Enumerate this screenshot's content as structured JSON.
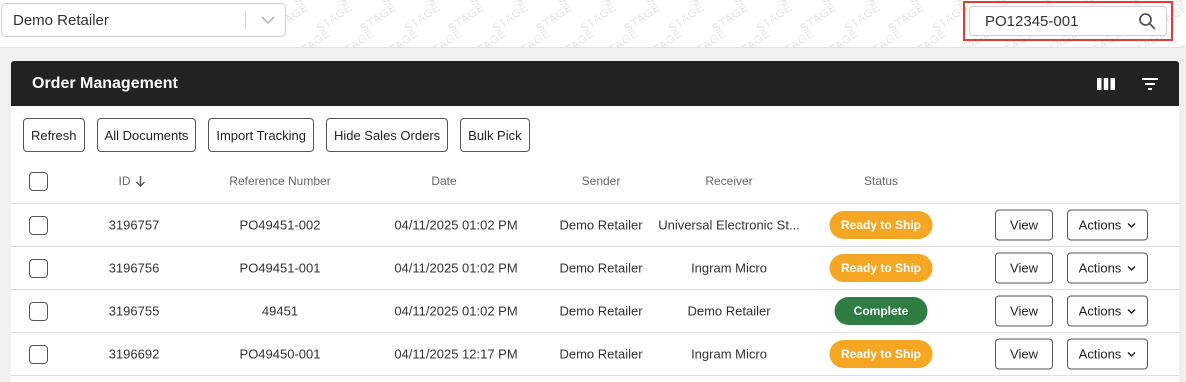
{
  "retailer_select": {
    "value": "Demo Retailer"
  },
  "search": {
    "value": "PO12345-001"
  },
  "watermark_text": "STAGE",
  "card": {
    "title": "Order Management"
  },
  "toolbar": {
    "refresh": "Refresh",
    "all_documents": "All Documents",
    "import_tracking": "Import Tracking",
    "hide_sales_orders": "Hide Sales Orders",
    "bulk_pick": "Bulk Pick"
  },
  "columns": {
    "id": "ID",
    "reference_number": "Reference Number",
    "date": "Date",
    "sender": "Sender",
    "receiver": "Receiver",
    "status": "Status"
  },
  "rows": [
    {
      "id": "3196757",
      "reference": "PO49451-002",
      "date": "04/11/2025 01:02 PM",
      "sender": "Demo Retailer",
      "receiver": "Universal Electronic St...",
      "status": "Ready to Ship"
    },
    {
      "id": "3196756",
      "reference": "PO49451-001",
      "date": "04/11/2025 01:02 PM",
      "sender": "Demo Retailer",
      "receiver": "Ingram Micro",
      "status": "Ready to Ship"
    },
    {
      "id": "3196755",
      "reference": "49451",
      "date": "04/11/2025 01:02 PM",
      "sender": "Demo Retailer",
      "receiver": "Demo Retailer",
      "status": "Complete"
    },
    {
      "id": "3196692",
      "reference": "PO49450-001",
      "date": "04/11/2025 12:17 PM",
      "sender": "Demo Retailer",
      "receiver": "Ingram Micro",
      "status": "Ready to Ship"
    }
  ],
  "row_actions": {
    "view": "View",
    "actions": "Actions"
  },
  "colors": {
    "header_bg": "#222222",
    "ready_to_ship": "#f5a623",
    "complete": "#2e7d42",
    "highlight_border": "#e53935"
  },
  "icons": {
    "select_chevron": "chevron-down-icon",
    "search": "search-icon",
    "columns": "columns-icon",
    "filter": "filter-icon",
    "sort": "arrow-down-icon",
    "actions_chevron": "chevron-down-icon"
  }
}
